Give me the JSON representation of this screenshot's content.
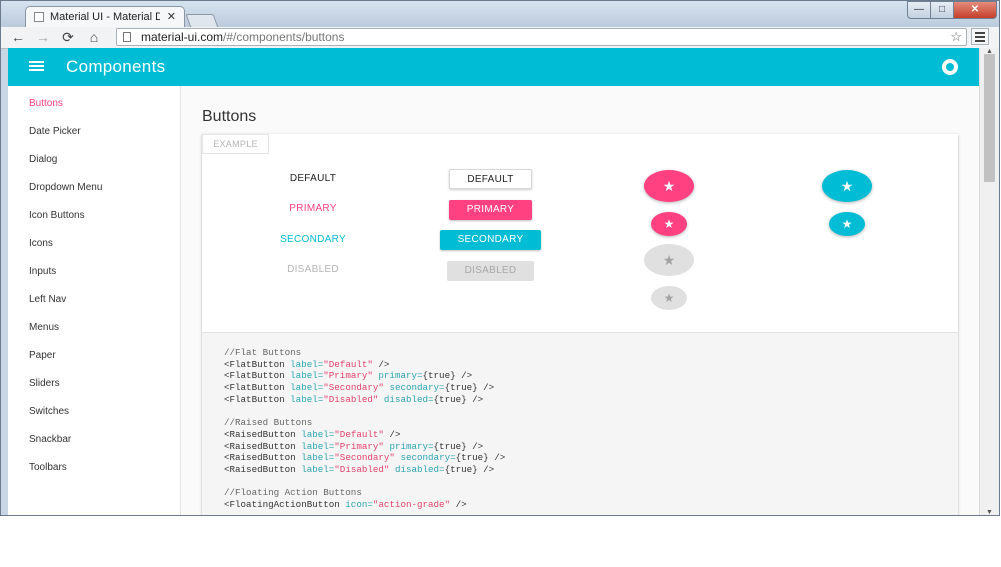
{
  "browser": {
    "tab_title": "Material UI - Material Desi",
    "tab_close": "✕",
    "url_host": "material-ui.com",
    "url_path": "/#/components/buttons",
    "window_buttons": {
      "minimize": "—",
      "maximize": "□",
      "close": "✕"
    },
    "nav": {
      "back": "←",
      "forward": "→",
      "reload": "⟳",
      "home": "⌂",
      "star": "☆"
    }
  },
  "appbar": {
    "title": "Components",
    "color": "#00bcd4"
  },
  "sidebar": {
    "items": [
      {
        "label": "Buttons",
        "active": true
      },
      {
        "label": "Date Picker"
      },
      {
        "label": "Dialog"
      },
      {
        "label": "Dropdown Menu"
      },
      {
        "label": "Icon Buttons"
      },
      {
        "label": "Icons"
      },
      {
        "label": "Inputs"
      },
      {
        "label": "Left Nav"
      },
      {
        "label": "Menus"
      },
      {
        "label": "Paper"
      },
      {
        "label": "Sliders"
      },
      {
        "label": "Switches"
      },
      {
        "label": "Snackbar"
      },
      {
        "label": "Toolbars"
      }
    ]
  },
  "main": {
    "heading": "Buttons",
    "example_tag": "EXAMPLE",
    "flat_buttons": [
      "DEFAULT",
      "PRIMARY",
      "SECONDARY",
      "DISABLED"
    ],
    "raised_buttons": [
      "DEFAULT",
      "PRIMARY",
      "SECONDARY",
      "DISABLED"
    ],
    "fab_icon": "★",
    "colors": {
      "primary": "#ff4081",
      "secondary": "#00bcd4",
      "disabled": "#e0e0e0"
    },
    "code": {
      "flat_comment": "//Flat Buttons",
      "raised_comment": "//Raised Buttons",
      "fab_comment": "//Floating Action Buttons",
      "flat_lines": [
        [
          "<FlatButton ",
          "label=",
          "\"Default\"",
          " />",
          "",
          ""
        ],
        [
          "<FlatButton ",
          "label=",
          "\"Primary\"",
          " ",
          "primary=",
          "{true} />"
        ],
        [
          "<FlatButton ",
          "label=",
          "\"Secondary\"",
          " ",
          "secondary=",
          "{true} />"
        ],
        [
          "<FlatButton ",
          "label=",
          "\"Disabled\"",
          " ",
          "disabled=",
          "{true} />"
        ]
      ],
      "raised_lines": [
        [
          "<RaisedButton ",
          "label=",
          "\"Default\"",
          " />",
          "",
          ""
        ],
        [
          "<RaisedButton ",
          "label=",
          "\"Primary\"",
          " ",
          "primary=",
          "{true} />"
        ],
        [
          "<RaisedButton ",
          "label=",
          "\"Secondary\"",
          " ",
          "secondary=",
          "{true} />"
        ],
        [
          "<RaisedButton ",
          "label=",
          "\"Disabled\"",
          " ",
          "disabled=",
          "{true} />"
        ]
      ],
      "fab_lines": [
        [
          "<FloatingActionButton ",
          "icon=",
          "\"action-grade\"",
          " />",
          "",
          ""
        ]
      ]
    }
  }
}
